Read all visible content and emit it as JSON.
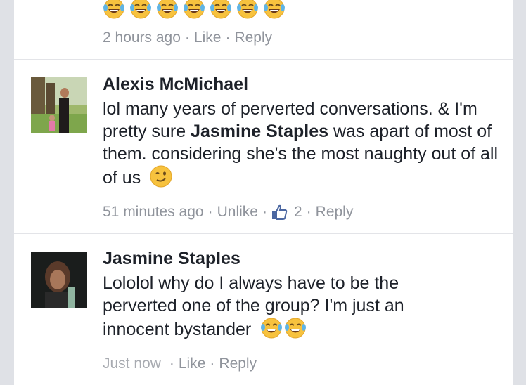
{
  "comments": [
    {
      "emoji_count": 7,
      "emoji": "face-with-tears-of-joy-icon",
      "time": "2 hours ago",
      "like": "Like",
      "reply": "Reply"
    },
    {
      "author": "Alexis McMichael",
      "text_1": "lol many years of perverted conversations. & I'm pretty sure ",
      "mention": "Jasmine Staples",
      "text_2": " was apart of most of them. considering she's the most naughty out of all of us",
      "emoji": "winking-face-icon",
      "time": "51 minutes ago",
      "unlike": "Unlike",
      "like_count": "2",
      "reply": "Reply"
    },
    {
      "author": "Jasmine Staples",
      "text": "Lololol why do I always have to be the perverted one of the group? I'm just an innocent bystander",
      "emoji": "face-with-tears-of-joy-icon",
      "emoji_count": 2,
      "time": "Just now",
      "like": "Like",
      "reply": "Reply"
    }
  ],
  "colors": {
    "background": "#dfe1e6",
    "panel": "#ffffff",
    "text": "#1d2129",
    "meta": "#90949c",
    "link": "#4b67a1",
    "divider": "#e3e4e8"
  }
}
